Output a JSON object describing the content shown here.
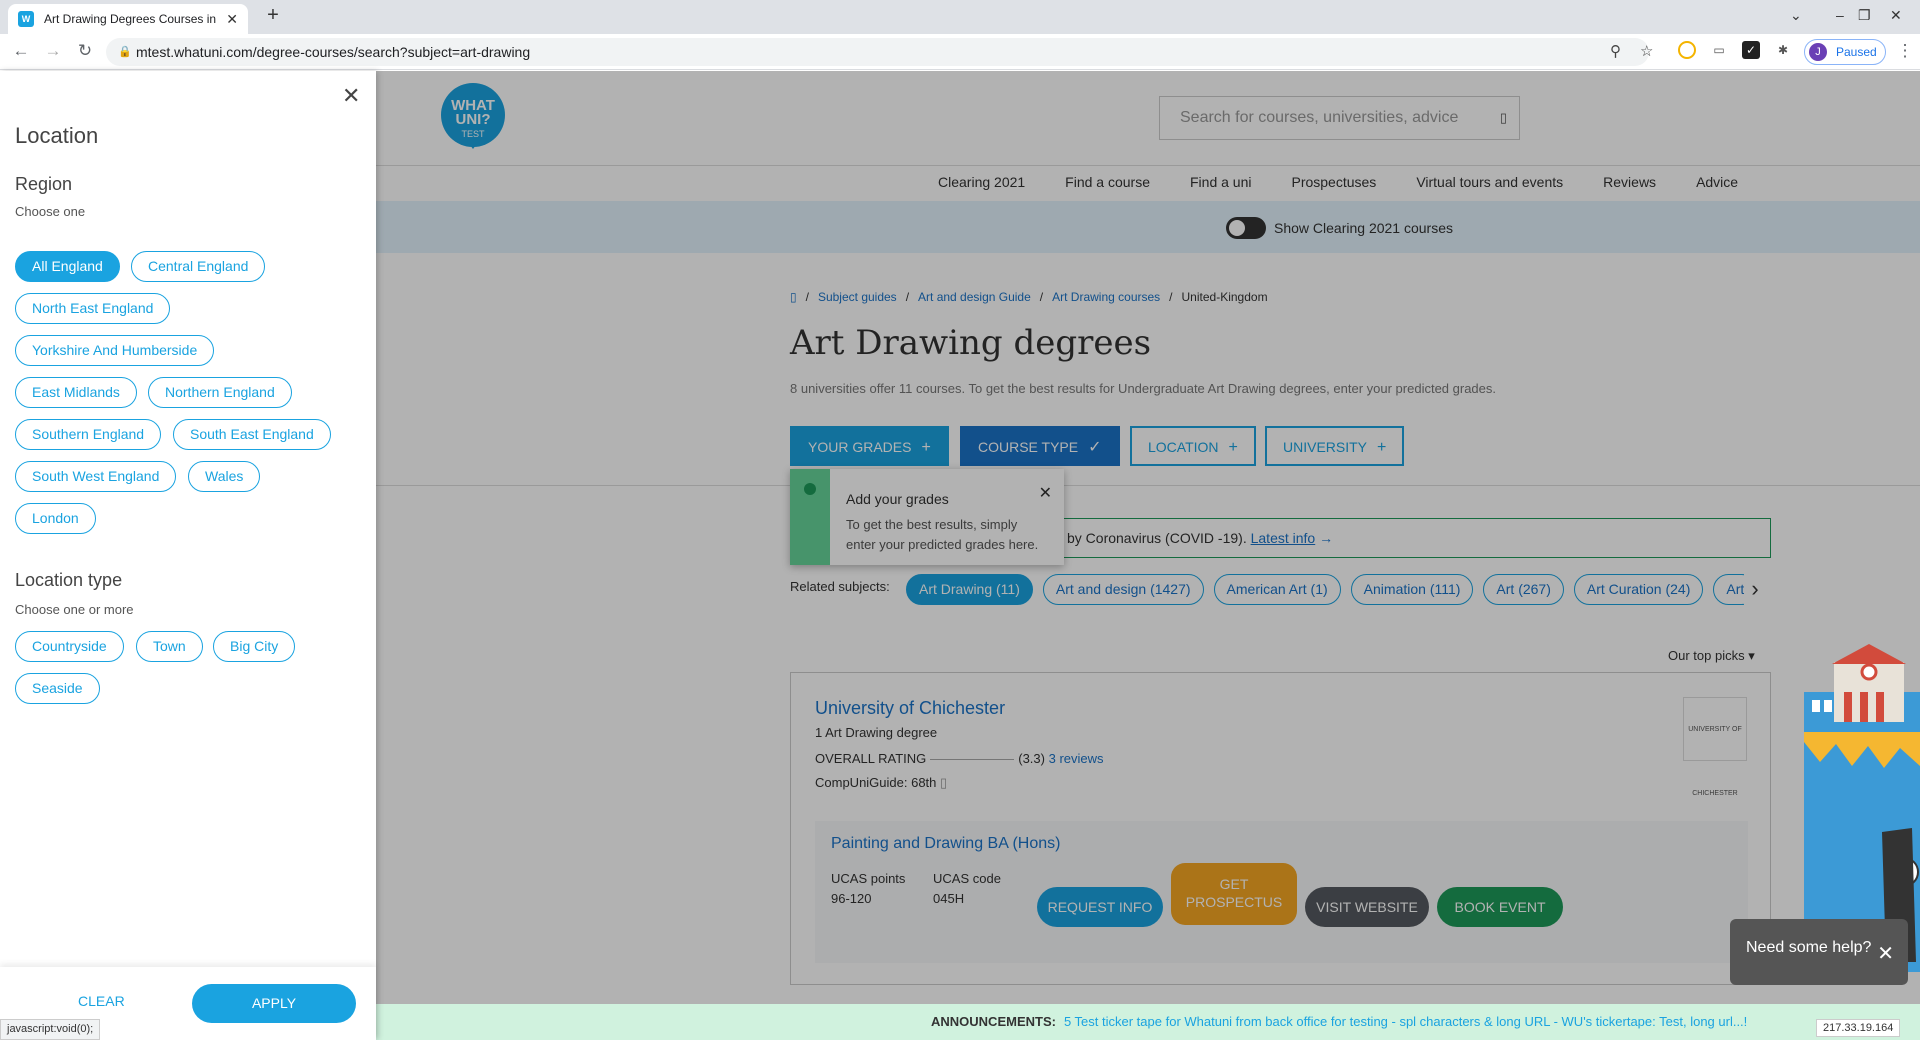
{
  "browser": {
    "tab_title": "Art Drawing Degrees Courses in U",
    "tab_favicon": "wu-favicon",
    "new_tab": "+",
    "url": "mtest.whatuni.com/degree-courses/search?subject=art-drawing",
    "profile_initial": "J",
    "profile_status": "Paused"
  },
  "site": {
    "logo_text": "WHAT UNI?",
    "logo_sub": "TEST",
    "search_placeholder": "Search for courses, universities, advice",
    "nav": [
      "Clearing 2021",
      "Find a course",
      "Find a uni",
      "Prospectuses",
      "Virtual tours and events",
      "Reviews",
      "Advice"
    ],
    "clearing_toggle_label": "Show Clearing 2021 courses"
  },
  "breadcrumb": {
    "items": [
      "Subject guides",
      "Art and design Guide",
      "Art Drawing courses"
    ],
    "current": "United-Kingdom"
  },
  "results": {
    "title": "Art Drawing degrees",
    "lead": "8 universities offer 11 courses. To get the best results for Undergraduate Art Drawing degrees, enter your predicted grades.",
    "filters": [
      "YOUR GRADES",
      "COURSE TYPE",
      "LOCATION",
      "UNIVERSITY"
    ],
    "tooltip": {
      "title": "Add your grades",
      "body": "To get the best results, simply enter your predicted grades here."
    },
    "covid_text": "by Coronavirus (COVID -19).",
    "covid_link": "Latest info",
    "related_label": "Related subjects:",
    "related": [
      "Art Drawing (11)",
      "Art and design (1427)",
      "American Art (1)",
      "Animation (111)",
      "Art (267)",
      "Art Curation (24)",
      "Art"
    ],
    "sort_label": "Our top picks"
  },
  "card": {
    "uni_name": "University of Chichester",
    "course_count": "1 Art Drawing degree",
    "rating_label": "OVERALL RATING",
    "rating_value": "(3.3)",
    "reviews_link": "3 reviews",
    "compuni": "CompUniGuide: 68th",
    "logo_text": "UNIVERSITY OF CHICHESTER",
    "course_name": "Painting and Drawing BA (Hons)",
    "ucas_points_label": "UCAS points",
    "ucas_points": "96-120",
    "ucas_code_label": "UCAS code",
    "ucas_code": "045H",
    "actions": [
      "REQUEST INFO",
      "GET PROSPECTUS",
      "VISIT WEBSITE",
      "BOOK EVENT"
    ],
    "action_colors": [
      "#1aa3e0",
      "#f5a623",
      "#555a60",
      "#1d9a5a"
    ]
  },
  "help": {
    "label": "Need some help?"
  },
  "ticker": {
    "label": "ANNOUNCEMENTS:",
    "text": "5 Test ticker tape for Whatuni from back office for testing - spl characters & long URL - WU's tickertape: Test, long url...!"
  },
  "ip": "217.33.19.164",
  "status_url": "javascript:void(0);",
  "panel": {
    "title": "Location",
    "region_heading": "Region",
    "region_hint": "Choose one",
    "regions": [
      "All England",
      "Central England",
      "North East England",
      "Yorkshire And Humberside",
      "East Midlands",
      "Northern England",
      "Southern England",
      "South East England",
      "South West England",
      "Wales",
      "London"
    ],
    "type_heading": "Location type",
    "type_hint": "Choose one or more",
    "types": [
      "Countryside",
      "Town",
      "Big City",
      "Seaside"
    ],
    "clear": "CLEAR",
    "apply": "APPLY"
  },
  "colors": {
    "brand": "#1aa3e0",
    "link": "#1a73c8",
    "green": "#1d9a5a"
  }
}
